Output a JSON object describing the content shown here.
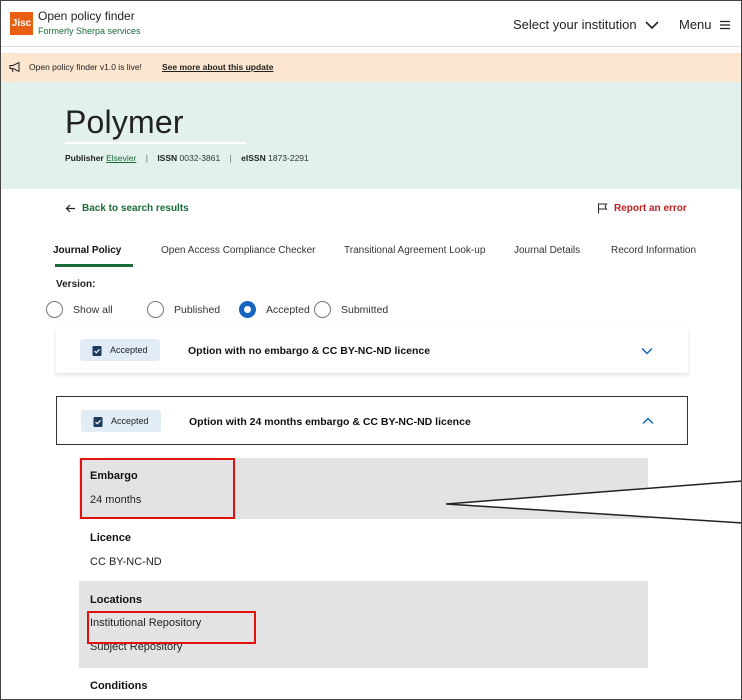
{
  "header": {
    "logo": "Jisc",
    "title": "Open policy finder",
    "subtitle": "Formerly Sherpa services",
    "institution_select": "Select your institution",
    "menu_label": "Menu"
  },
  "banner": {
    "text": "Open policy finder v1.0 is live!",
    "link": "See more about this update"
  },
  "journal": {
    "name": "Polymer",
    "publisher_label": "Publisher",
    "publisher": "Elsevier",
    "issn_label": "ISSN",
    "issn": "0032-3861",
    "eissn_label": "eISSN",
    "eissn": "1873-2291"
  },
  "actions": {
    "back": "Back to search results",
    "report": "Report an error"
  },
  "tabs": [
    {
      "label": "Journal Policy",
      "active": true
    },
    {
      "label": "Open Access Compliance Checker",
      "active": false
    },
    {
      "label": "Transitional Agreement Look-up",
      "active": false
    },
    {
      "label": "Journal Details",
      "active": false
    },
    {
      "label": "Record Information",
      "active": false
    }
  ],
  "version": {
    "label": "Version:",
    "options": [
      {
        "label": "Show all",
        "selected": false
      },
      {
        "label": "Published",
        "selected": false
      },
      {
        "label": "Accepted",
        "selected": true
      },
      {
        "label": "Submitted",
        "selected": false
      }
    ]
  },
  "options": [
    {
      "badge": "Accepted",
      "title": "Option with no embargo & CC BY-NC-ND licence",
      "expanded": false
    },
    {
      "badge": "Accepted",
      "title": "Option with 24 months embargo & CC BY-NC-ND licence",
      "expanded": true
    }
  ],
  "details": {
    "embargo_label": "Embargo",
    "embargo_value": "24 months",
    "licence_label": "Licence",
    "licence_value": "CC BY-NC-ND",
    "locations_label": "Locations",
    "locations": [
      "Institutional Repository",
      "Subject Repository"
    ],
    "conditions_label": "Conditions"
  },
  "colors": {
    "brand_orange": "#e85e13",
    "brand_green": "#1b6b3a",
    "hero_bg": "#e2f1eb",
    "banner_bg": "#fce6cf",
    "accent_blue": "#1565c0",
    "error_red": "#c02020",
    "highlight_red": "#e01010"
  }
}
